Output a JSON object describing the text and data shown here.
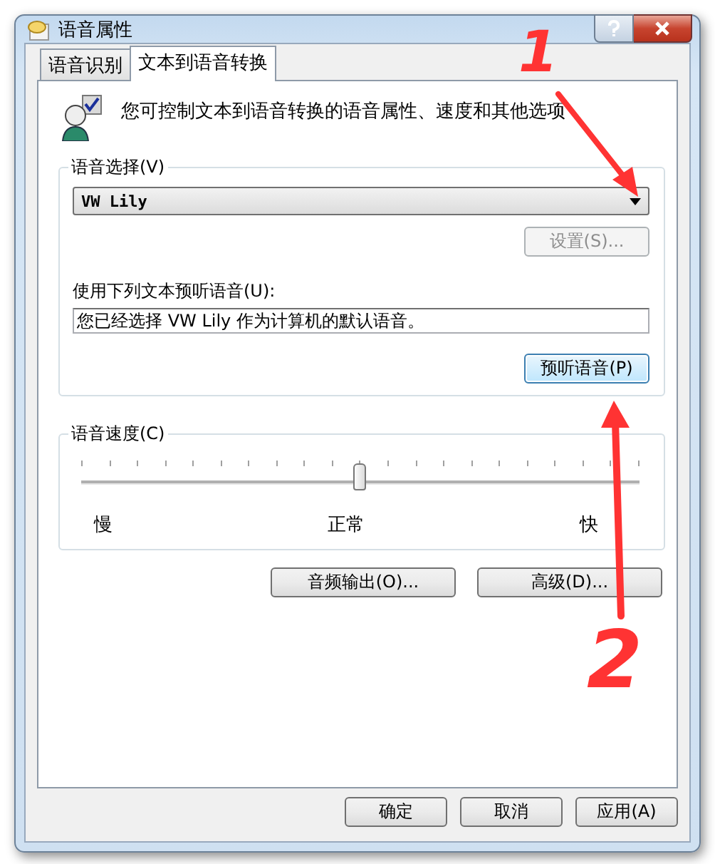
{
  "window": {
    "title": "语音属性"
  },
  "tabs": [
    {
      "label": "语音识别",
      "selected": false
    },
    {
      "label": "文本到语音转换",
      "selected": true
    }
  ],
  "intro": "您可控制文本到语音转换的语音属性、速度和其他选项",
  "voice_group": {
    "title": "语音选择(V)",
    "dropdown": "VW Lily",
    "settings_button": {
      "label": "设置(S)...",
      "disabled": true
    },
    "preview_label": "使用下列文本预听语音(U):",
    "preview_text": "您已经选择 VW Lily 作为计算机的默认语音。",
    "preview_button": "预听语音(P)"
  },
  "speed_group": {
    "title": "语音速度(C)",
    "level": 0.5,
    "labels": [
      "慢",
      "正常",
      "快"
    ]
  },
  "buttons": [
    "音频输出(O)...",
    "高级(D)..."
  ],
  "dialog_buttons": [
    "确定",
    "取消",
    "应用(A)"
  ],
  "annotations": [
    {
      "text": "1"
    },
    {
      "text": "2"
    }
  ]
}
